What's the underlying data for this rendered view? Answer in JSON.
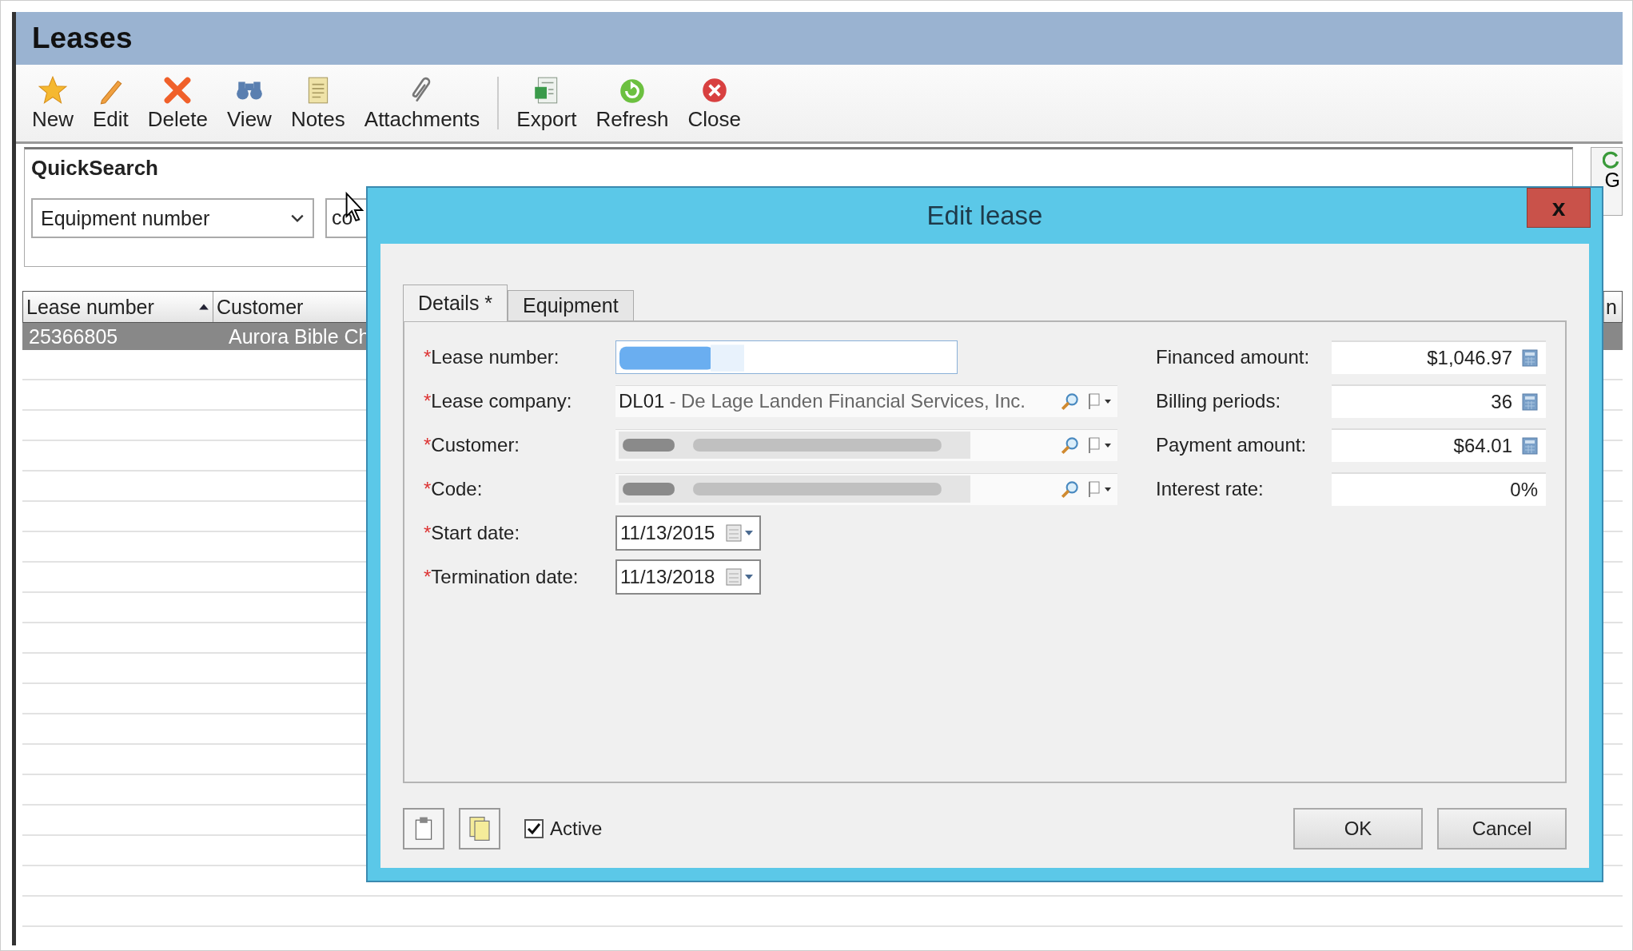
{
  "window": {
    "title": "Leases"
  },
  "toolbar": {
    "groups": [
      [
        {
          "label": "New"
        },
        {
          "label": "Edit"
        },
        {
          "label": "Delete"
        },
        {
          "label": "View"
        },
        {
          "label": "Notes"
        },
        {
          "label": "Attachments"
        }
      ],
      [
        {
          "label": "Export"
        },
        {
          "label": "Refresh"
        },
        {
          "label": "Close"
        }
      ]
    ]
  },
  "quick_search": {
    "title": "QuickSearch",
    "field": "Equipment number",
    "value": "co"
  },
  "side_button": {
    "label": "G"
  },
  "grid": {
    "columns": [
      {
        "label": "Lease number",
        "sorted": true
      },
      {
        "label": "Customer",
        "sorted": false
      },
      {
        "label": "n",
        "sorted": false
      }
    ],
    "rows": [
      {
        "cells": [
          "25366805",
          "Aurora Bible Ch"
        ],
        "selected": true
      }
    ]
  },
  "dialog": {
    "title": "Edit lease",
    "close": "x",
    "required_mark": "*",
    "tabs": [
      {
        "label": "Details *",
        "selected": true
      },
      {
        "label": "Equipment",
        "selected": false
      }
    ],
    "left_fields": [
      {
        "kind": "text",
        "label": "Lease number:",
        "required": true
      },
      {
        "kind": "lookup",
        "label": "Lease company:",
        "required": true,
        "code": "DL01",
        "name": "- De Lage Landen Financial Services, Inc."
      },
      {
        "kind": "lookup",
        "label": "Customer:",
        "required": true
      },
      {
        "kind": "lookup",
        "label": "Code:",
        "required": true
      },
      {
        "kind": "date",
        "label": "Start date:",
        "required": true,
        "value": "11/13/2015"
      },
      {
        "kind": "date",
        "label": "Termination date:",
        "required": true,
        "value": "11/13/2018"
      }
    ],
    "right_fields": [
      {
        "label": "Financed amount:",
        "value": "$1,046.97",
        "calculator": true
      },
      {
        "label": "Billing periods:",
        "value": "36",
        "calculator": true
      },
      {
        "label": "Payment amount:",
        "value": "$64.01",
        "calculator": true
      },
      {
        "label": "Interest rate:",
        "value": "0%",
        "calculator": false
      }
    ],
    "active": {
      "label": "Active",
      "checked": true
    },
    "buttons": [
      "OK",
      "Cancel"
    ]
  }
}
